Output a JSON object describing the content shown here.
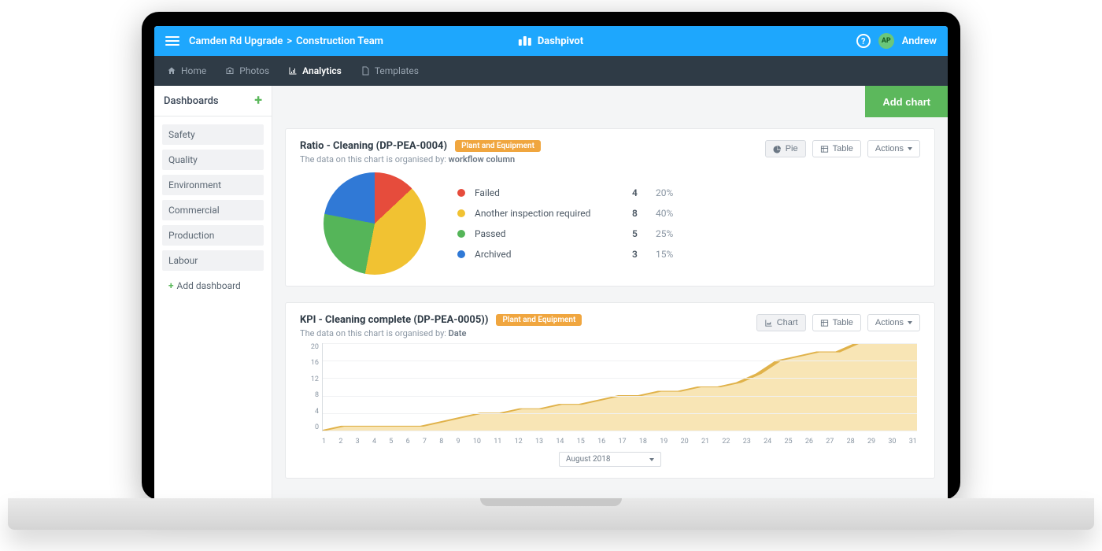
{
  "header": {
    "breadcrumb_root": "Camden Rd Upgrade",
    "breadcrumb_leaf": "Construction Team",
    "app_name": "Dashpivot",
    "user_initials": "AP",
    "user_name": "Andrew"
  },
  "nav": {
    "home": "Home",
    "photos": "Photos",
    "analytics": "Analytics",
    "templates": "Templates"
  },
  "sidebar": {
    "heading": "Dashboards",
    "items": [
      "Safety",
      "Quality",
      "Environment",
      "Commercial",
      "Production",
      "Labour"
    ],
    "add_label": "Add dashboard"
  },
  "buttons": {
    "add_chart": "Add chart",
    "pie": "Pie",
    "table": "Table",
    "chart": "Chart",
    "actions": "Actions"
  },
  "card1": {
    "title": "Ratio - Cleaning (DP-PEA-0004)",
    "tag": "Plant and Equipment",
    "sub_prefix": "The data on this chart is organised by: ",
    "sub_value": "workflow column",
    "legend": [
      {
        "label": "Failed",
        "count": "4",
        "pct": "20%",
        "color": "#e64c3c"
      },
      {
        "label": "Another inspection required",
        "count": "8",
        "pct": "40%",
        "color": "#f1c232"
      },
      {
        "label": "Passed",
        "count": "5",
        "pct": "25%",
        "color": "#55b559"
      },
      {
        "label": "Archived",
        "count": "3",
        "pct": "15%",
        "color": "#3079d6"
      }
    ]
  },
  "card2": {
    "title": "KPI - Cleaning complete (DP-PEA-0005))",
    "tag": "Plant and Equipment",
    "sub_prefix": "The data on this chart is organised by: ",
    "sub_value": "Date",
    "y_ticks": [
      "20",
      "16",
      "12",
      "8",
      "4",
      "0"
    ],
    "x_ticks": [
      "1",
      "2",
      "3",
      "4",
      "5",
      "6",
      "7",
      "8",
      "9",
      "10",
      "11",
      "12",
      "13",
      "14",
      "15",
      "16",
      "17",
      "18",
      "19",
      "20",
      "21",
      "22",
      "23",
      "24",
      "25",
      "26",
      "27",
      "28",
      "29",
      "30",
      "31"
    ],
    "period": "August 2018"
  },
  "colors": {
    "blue": "#1ea7fd",
    "dark": "#2f3b46",
    "green": "#5cb85c",
    "tag": "#f0a63f"
  },
  "chart_data": [
    {
      "type": "pie",
      "title": "Ratio - Cleaning (DP-PEA-0004)",
      "categories": [
        "Failed",
        "Another inspection required",
        "Passed",
        "Archived"
      ],
      "values": [
        4,
        8,
        5,
        3
      ],
      "percentages": [
        20,
        40,
        25,
        15
      ],
      "colors": [
        "#e64c3c",
        "#f1c232",
        "#55b559",
        "#3079d6"
      ]
    },
    {
      "type": "area",
      "title": "KPI - Cleaning complete (DP-PEA-0005))",
      "xlabel": "",
      "ylabel": "",
      "ylim": [
        0,
        20
      ],
      "x": [
        1,
        2,
        3,
        4,
        5,
        6,
        7,
        8,
        9,
        10,
        11,
        12,
        13,
        14,
        15,
        16,
        17,
        18,
        19,
        20,
        21,
        22,
        23,
        24,
        25,
        26,
        27,
        28,
        29,
        30,
        31
      ],
      "values": [
        0,
        1,
        1,
        1,
        1,
        1,
        2,
        3,
        4,
        4,
        5,
        5,
        6,
        6,
        7,
        8,
        8,
        9,
        9,
        10,
        10,
        11,
        13,
        16,
        17,
        18,
        18,
        20,
        21,
        21,
        21
      ],
      "period": "August 2018"
    }
  ]
}
